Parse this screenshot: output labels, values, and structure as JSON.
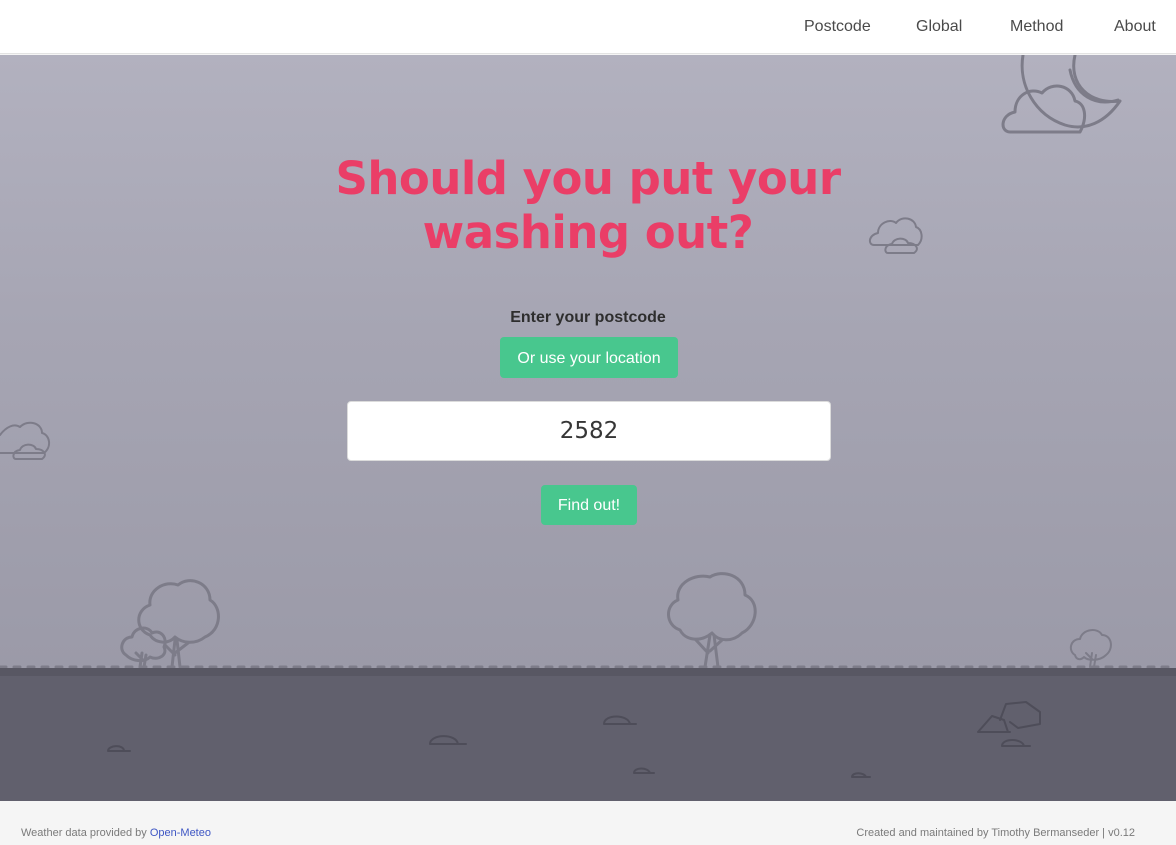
{
  "nav": {
    "items": [
      {
        "label": "Postcode"
      },
      {
        "label": "Global"
      },
      {
        "label": "Method"
      },
      {
        "label": "About"
      }
    ]
  },
  "hero": {
    "title": "Should you put your washing out?",
    "postcode_label": "Enter your postcode",
    "location_button": "Or use your location",
    "postcode_value": "2582",
    "find_button": "Find out!"
  },
  "footer": {
    "data_credit_prefix": "Weather data provided by",
    "data_credit_link": "Open-Meteo",
    "credit": "Created and maintained by Timothy Bermanseder | v0.12"
  },
  "colors": {
    "accent": "#ea3e67",
    "button": "#48c78e",
    "link": "#3e56c4",
    "outline": "#7d7c89"
  },
  "icons": [
    "moon-icon",
    "cloud-icon",
    "tree-icon",
    "bush-icon",
    "rock-icon"
  ]
}
